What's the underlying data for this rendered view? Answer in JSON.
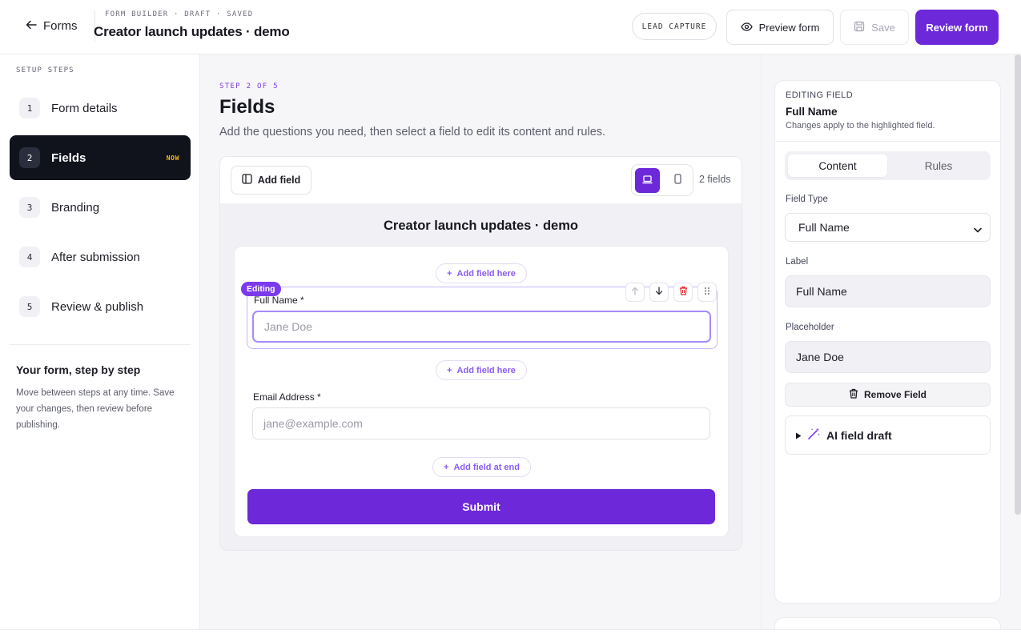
{
  "header": {
    "back_label": "Forms",
    "meta": "FORM BUILDER · DRAFT · SAVED",
    "title": "Creator launch updates · demo",
    "lead_badge": "LEAD CAPTURE",
    "preview_label": "Preview form",
    "save_label": "Save",
    "review_label": "Review form"
  },
  "sidebar": {
    "heading": "SETUP STEPS",
    "steps": [
      {
        "num": "1",
        "label": "Form details"
      },
      {
        "num": "2",
        "label": "Fields",
        "badge": "NOW"
      },
      {
        "num": "3",
        "label": "Branding"
      },
      {
        "num": "4",
        "label": "After submission"
      },
      {
        "num": "5",
        "label": "Review & publish"
      }
    ],
    "help_title": "Your form, step by step",
    "help_text": "Move between steps at any time. Save your changes, then review before publishing."
  },
  "main": {
    "kicker": "STEP 2 OF 5",
    "title": "Fields",
    "description": "Add the questions you need, then select a field to edit its content and rules.",
    "add_field_label": "Add field",
    "fields_count": "2 fields",
    "form_title": "Creator launch updates · demo",
    "add_field_here": "Add field here",
    "add_field_end": "Add field at end",
    "editing_tag": "Editing",
    "fields": [
      {
        "label": "Full Name *",
        "placeholder": "Jane Doe"
      },
      {
        "label": "Email Address *",
        "placeholder": "jane@example.com"
      }
    ],
    "submit_label": "Submit"
  },
  "panel": {
    "kicker": "EDITING FIELD",
    "title": "Full Name",
    "subtitle": "Changes apply to the highlighted field.",
    "tabs": {
      "content": "Content",
      "rules": "Rules"
    },
    "field_type_label": "Field Type",
    "field_type_value": "Full Name",
    "label_label": "Label",
    "label_value": "Full Name",
    "placeholder_label": "Placeholder",
    "placeholder_value": "Jane Doe",
    "remove_label": "Remove Field",
    "ai_label": "AI field draft"
  },
  "colors": {
    "accent": "#6d28d9",
    "accent_light": "#a78bfa",
    "dark_nav": "#10121c",
    "now_badge": "#f5b722",
    "danger": "#dc2626"
  }
}
